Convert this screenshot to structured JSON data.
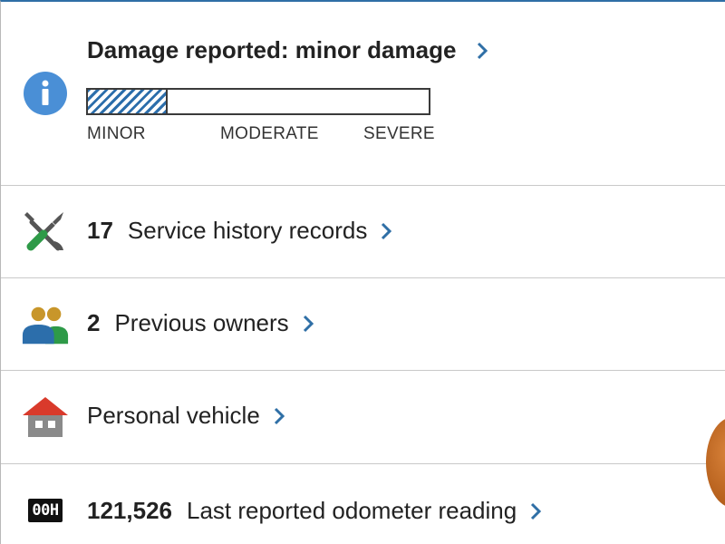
{
  "damage": {
    "title": "Damage reported: minor damage",
    "level_fraction": 0.235,
    "scale": {
      "minor": "MINOR",
      "moderate": "MODERATE",
      "severe": "SEVERE"
    },
    "icon": "info-icon",
    "icon_color": "#4a8fd6"
  },
  "service": {
    "count": "17",
    "label": "Service history records",
    "icon": "wrench-screwdriver-icon"
  },
  "owners": {
    "count": "2",
    "label": "Previous owners",
    "icon": "people-icon"
  },
  "usage": {
    "label": "Personal vehicle",
    "icon": "house-icon"
  },
  "odometer": {
    "count": "121,526",
    "label": "Last reported odometer reading",
    "icon": "odometer-icon",
    "icon_text": "00H"
  },
  "colors": {
    "accent": "#2c6eab",
    "chevron": "#2f6fa6",
    "divider": "#c9c9c9"
  }
}
